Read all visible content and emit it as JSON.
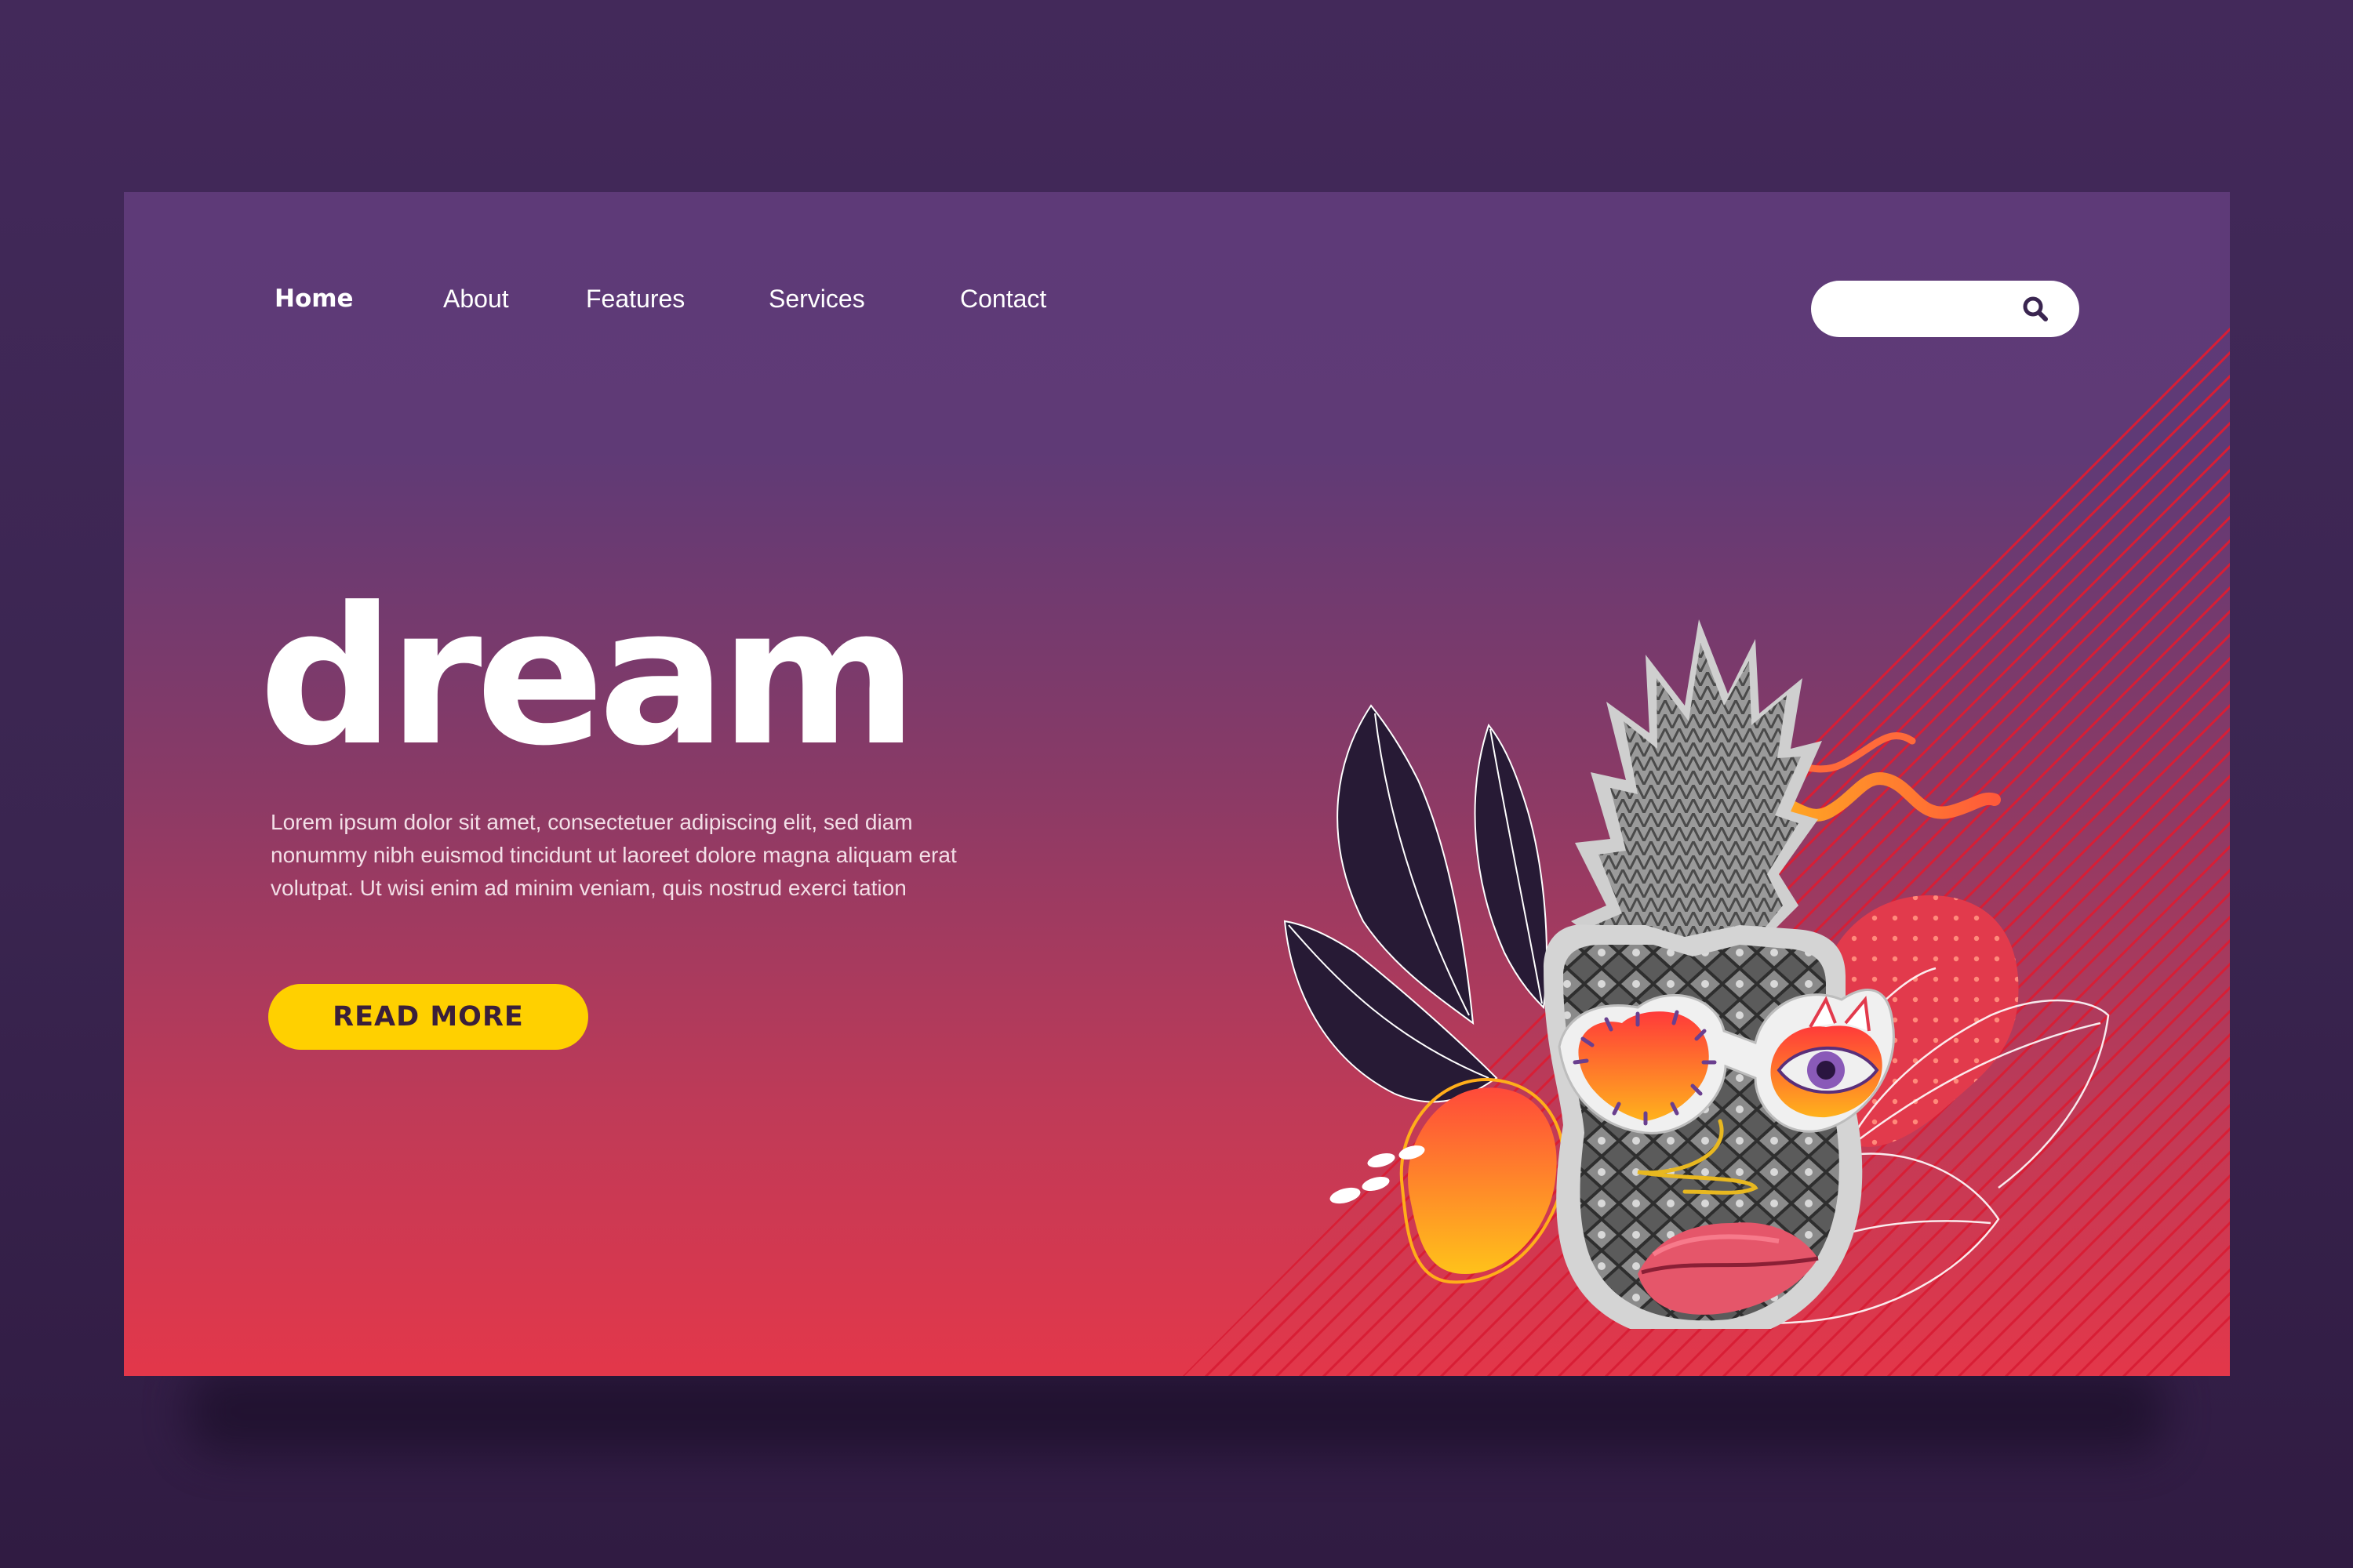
{
  "nav": {
    "items": [
      {
        "label": "Home",
        "active": true
      },
      {
        "label": "About"
      },
      {
        "label": "Features"
      },
      {
        "label": "Services"
      },
      {
        "label": "Contact"
      }
    ]
  },
  "search": {
    "placeholder": "",
    "icon": "search-icon"
  },
  "hero": {
    "title": "dream",
    "body": "Lorem ipsum dolor sit amet, consectetuer adipiscing elit, sed diam nonummy nibh euismod tincidunt ut laoreet dolore magna aliquam erat volutpat. Ut wisi enim ad minim veniam, quis nostrud exerci tation",
    "cta_label": "READ MORE"
  },
  "colors": {
    "outer_background": "#3a2550",
    "page_gradient_top": "#5e3a78",
    "page_gradient_bottom": "#e3374a",
    "accent_yellow": "#ffd000",
    "stripe_red": "#d81e35",
    "nav_text": "#ffffff"
  },
  "illustration": {
    "subject": "pineapple-collage",
    "elements": [
      "leaves",
      "sunglasses",
      "eye",
      "lips",
      "squiggle",
      "orange-blob",
      "dotted-blob",
      "line-leaves"
    ]
  }
}
